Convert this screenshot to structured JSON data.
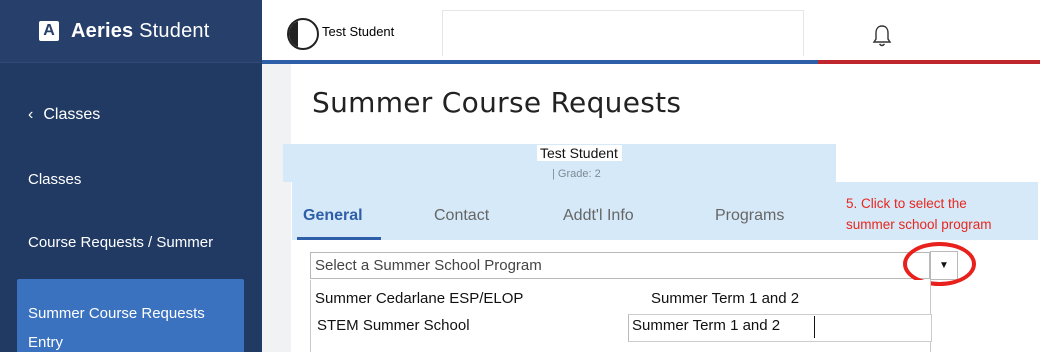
{
  "app": {
    "brand_bold": "Aeries",
    "brand_light": "Student",
    "logo_letter": "A"
  },
  "sidebar": {
    "back_label": "Classes",
    "items": [
      {
        "label": "Classes"
      },
      {
        "label": "Course Requests / Summer"
      },
      {
        "label": "Summer Course Requests Entry"
      }
    ]
  },
  "header": {
    "user_name": "Test Student"
  },
  "page": {
    "title": "Summer Course Requests"
  },
  "student": {
    "name": "Test Student",
    "grade": "| Grade: 2"
  },
  "tabs": [
    {
      "label": "General",
      "active": true
    },
    {
      "label": "Contact"
    },
    {
      "label": "Addt'l Info"
    },
    {
      "label": "Programs"
    }
  ],
  "annotation": {
    "line1": "5. Click to select the",
    "line2": "summer school program"
  },
  "select": {
    "placeholder": "Select a Summer School Program",
    "options": [
      {
        "name": "Summer Cedarlane ESP/ELOP",
        "term": "Summer Term 1 and 2"
      },
      {
        "name": "STEM Summer School",
        "term": "Summer Term 1 and 2"
      }
    ]
  },
  "colors": {
    "sidebar": "#213a64",
    "active_item": "#3a72c0",
    "accent": "#2f5ea8",
    "annotation": "#e8261f",
    "highlight": "#d6e9f8"
  },
  "icons": [
    "chevron-left-icon",
    "bell-icon",
    "caret-down-icon",
    "avatar-icon"
  ]
}
